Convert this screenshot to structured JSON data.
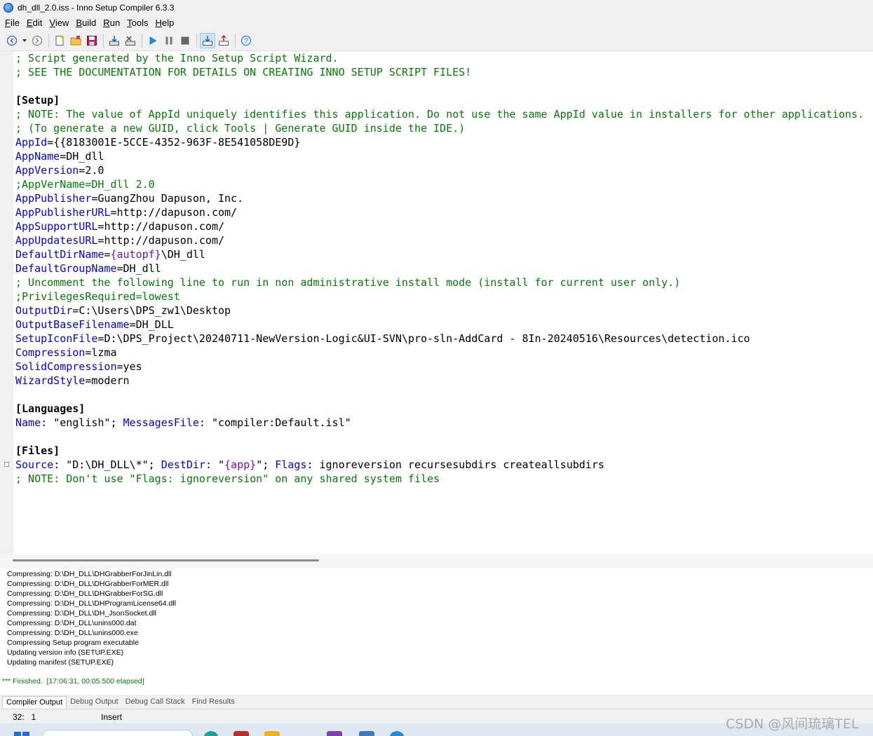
{
  "window": {
    "title": "dh_dll_2.0.iss - Inno Setup Compiler 6.3.3"
  },
  "menu": [
    {
      "first": "F",
      "rest": "ile"
    },
    {
      "first": "E",
      "rest": "dit"
    },
    {
      "first": "V",
      "rest": "iew"
    },
    {
      "first": "B",
      "rest": "uild"
    },
    {
      "first": "R",
      "rest": "un"
    },
    {
      "first": "T",
      "rest": "ools"
    },
    {
      "first": "H",
      "rest": "elp"
    }
  ],
  "toolbar": {
    "icons": [
      "back-icon",
      "dropdown-icon",
      "forward-icon",
      "new-file-icon",
      "open-folder-icon",
      "save-icon",
      "compile-icon",
      "stop-compile-icon",
      "run-icon",
      "pause-icon",
      "stop-icon",
      "target-setup-icon",
      "target-uninstall-icon",
      "help-icon"
    ]
  },
  "editor": {
    "lines": [
      [
        {
          "t": "; Script generated by the Inno Setup Script Wizard.",
          "c": "cmt"
        }
      ],
      [
        {
          "t": "; SEE THE DOCUMENTATION FOR DETAILS ON CREATING INNO SETUP SCRIPT FILES!",
          "c": "cmt"
        }
      ],
      [],
      [
        {
          "t": "[Setup]",
          "c": "sec"
        }
      ],
      [
        {
          "t": "; NOTE: The value of AppId uniquely identifies this application. Do not use the same AppId value in installers for other applications.",
          "c": "cmt"
        }
      ],
      [
        {
          "t": "; (To generate a new GUID, click Tools | Generate GUID inside the IDE.)",
          "c": "cmt"
        }
      ],
      [
        {
          "t": "AppId",
          "c": "key"
        },
        {
          "t": "=",
          "c": "eq"
        },
        {
          "t": "{{8183001E-5CCE-4352-963F-8E541058DE9D}",
          "c": "val"
        }
      ],
      [
        {
          "t": "AppName",
          "c": "key"
        },
        {
          "t": "=",
          "c": "eq"
        },
        {
          "t": "DH_dll",
          "c": "val"
        }
      ],
      [
        {
          "t": "AppVersion",
          "c": "key"
        },
        {
          "t": "=",
          "c": "eq"
        },
        {
          "t": "2.0",
          "c": "val"
        }
      ],
      [
        {
          "t": ";AppVerName=DH_dll 2.0",
          "c": "cmt"
        }
      ],
      [
        {
          "t": "AppPublisher",
          "c": "key"
        },
        {
          "t": "=",
          "c": "eq"
        },
        {
          "t": "GuangZhou Dapuson, Inc.",
          "c": "val"
        }
      ],
      [
        {
          "t": "AppPublisherURL",
          "c": "key"
        },
        {
          "t": "=",
          "c": "eq"
        },
        {
          "t": "http://dapuson.com/",
          "c": "val"
        }
      ],
      [
        {
          "t": "AppSupportURL",
          "c": "key"
        },
        {
          "t": "=",
          "c": "eq"
        },
        {
          "t": "http://dapuson.com/",
          "c": "val"
        }
      ],
      [
        {
          "t": "AppUpdatesURL",
          "c": "key"
        },
        {
          "t": "=",
          "c": "eq"
        },
        {
          "t": "http://dapuson.com/",
          "c": "val"
        }
      ],
      [
        {
          "t": "DefaultDirName",
          "c": "key"
        },
        {
          "t": "=",
          "c": "eq"
        },
        {
          "t": "{autopf}",
          "c": "const"
        },
        {
          "t": "\\DH_dll",
          "c": "val"
        }
      ],
      [
        {
          "t": "DefaultGroupName",
          "c": "key"
        },
        {
          "t": "=",
          "c": "eq"
        },
        {
          "t": "DH_dll",
          "c": "val"
        }
      ],
      [
        {
          "t": "; Uncomment the following line to run in non administrative install mode (install for current user only.)",
          "c": "cmt"
        }
      ],
      [
        {
          "t": ";PrivilegesRequired=lowest",
          "c": "cmt"
        }
      ],
      [
        {
          "t": "OutputDir",
          "c": "key"
        },
        {
          "t": "=",
          "c": "eq"
        },
        {
          "t": "C:\\Users\\DPS_zw1\\Desktop",
          "c": "val"
        }
      ],
      [
        {
          "t": "OutputBaseFilename",
          "c": "key"
        },
        {
          "t": "=",
          "c": "eq"
        },
        {
          "t": "DH_DLL",
          "c": "val"
        }
      ],
      [
        {
          "t": "SetupIconFile",
          "c": "key"
        },
        {
          "t": "=",
          "c": "eq"
        },
        {
          "t": "D:\\DPS_Project\\20240711-NewVersion-Logic&UI-SVN\\pro-sln-AddCard - 8In-20240516\\Resources\\detection.ico",
          "c": "val"
        }
      ],
      [
        {
          "t": "Compression",
          "c": "key"
        },
        {
          "t": "=",
          "c": "eq"
        },
        {
          "t": "lzma",
          "c": "val"
        }
      ],
      [
        {
          "t": "SolidCompression",
          "c": "key"
        },
        {
          "t": "=",
          "c": "eq"
        },
        {
          "t": "yes",
          "c": "val"
        }
      ],
      [
        {
          "t": "WizardStyle",
          "c": "key"
        },
        {
          "t": "=",
          "c": "eq"
        },
        {
          "t": "modern",
          "c": "val"
        }
      ],
      [],
      [
        {
          "t": "[Languages]",
          "c": "sec"
        }
      ],
      [
        {
          "t": "Name",
          "c": "key"
        },
        {
          "t": ": ",
          "c": "eq"
        },
        {
          "t": "\"english\"",
          "c": "val"
        },
        {
          "t": "; ",
          "c": "eq"
        },
        {
          "t": "MessagesFile",
          "c": "key"
        },
        {
          "t": ": ",
          "c": "eq"
        },
        {
          "t": "\"compiler:Default.isl\"",
          "c": "val"
        }
      ],
      [],
      [
        {
          "t": "[Files]",
          "c": "sec"
        }
      ],
      [
        {
          "t": "Source",
          "c": "key"
        },
        {
          "t": ": ",
          "c": "eq"
        },
        {
          "t": "\"D:\\DH_DLL\\*\"",
          "c": "val"
        },
        {
          "t": "; ",
          "c": "eq"
        },
        {
          "t": "DestDir",
          "c": "key"
        },
        {
          "t": ": ",
          "c": "eq"
        },
        {
          "t": "\"",
          "c": "val"
        },
        {
          "t": "{app}",
          "c": "const"
        },
        {
          "t": "\"",
          "c": "val"
        },
        {
          "t": "; ",
          "c": "eq"
        },
        {
          "t": "Flags",
          "c": "key"
        },
        {
          "t": ": ",
          "c": "eq"
        },
        {
          "t": "ignoreversion recursesubdirs createallsubdirs",
          "c": "val"
        }
      ],
      [
        {
          "t": "; NOTE: Don't use \"Flags: ignoreversion\" on any shared system files",
          "c": "cmt"
        }
      ]
    ]
  },
  "output": {
    "lines": [
      "Compressing: D:\\DH_DLL\\DHGrabberForJinLin.dll",
      "Compressing: D:\\DH_DLL\\DHGrabberForMER.dll",
      "Compressing: D:\\DH_DLL\\DHGrabberForSG.dll",
      "Compressing: D:\\DH_DLL\\DHProgramLicense64.dll",
      "Compressing: D:\\DH_DLL\\DH_JsonSocket.dll",
      "Compressing: D:\\DH_DLL\\unins000.dat",
      "Compressing: D:\\DH_DLL\\unins000.exe",
      "Compressing Setup program executable",
      "Updating version info (SETUP.EXE)",
      "Updating manifest (SETUP.EXE)"
    ],
    "finished": "*** Finished.  [17:06:31, 00:05.500 elapsed]"
  },
  "tabs": [
    "Compiler Output",
    "Debug Output",
    "Debug Call Stack",
    "Find Results"
  ],
  "status": {
    "position": "32:   1",
    "mode": "Insert"
  },
  "watermark": "CSDN @风间琉璃TEL",
  "colors": {
    "comment": "#008000",
    "key": "#0000ff",
    "constant": "#7a0fb5",
    "section": "#000000"
  }
}
